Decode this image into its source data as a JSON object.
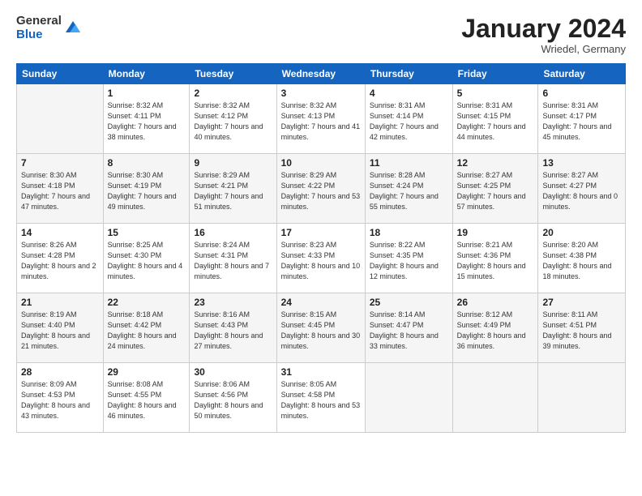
{
  "logo": {
    "general": "General",
    "blue": "Blue"
  },
  "title": "January 2024",
  "location": "Wriedel, Germany",
  "weekdays": [
    "Sunday",
    "Monday",
    "Tuesday",
    "Wednesday",
    "Thursday",
    "Friday",
    "Saturday"
  ],
  "weeks": [
    [
      {
        "num": "",
        "sunrise": "",
        "sunset": "",
        "daylight": ""
      },
      {
        "num": "1",
        "sunrise": "Sunrise: 8:32 AM",
        "sunset": "Sunset: 4:11 PM",
        "daylight": "Daylight: 7 hours and 38 minutes."
      },
      {
        "num": "2",
        "sunrise": "Sunrise: 8:32 AM",
        "sunset": "Sunset: 4:12 PM",
        "daylight": "Daylight: 7 hours and 40 minutes."
      },
      {
        "num": "3",
        "sunrise": "Sunrise: 8:32 AM",
        "sunset": "Sunset: 4:13 PM",
        "daylight": "Daylight: 7 hours and 41 minutes."
      },
      {
        "num": "4",
        "sunrise": "Sunrise: 8:31 AM",
        "sunset": "Sunset: 4:14 PM",
        "daylight": "Daylight: 7 hours and 42 minutes."
      },
      {
        "num": "5",
        "sunrise": "Sunrise: 8:31 AM",
        "sunset": "Sunset: 4:15 PM",
        "daylight": "Daylight: 7 hours and 44 minutes."
      },
      {
        "num": "6",
        "sunrise": "Sunrise: 8:31 AM",
        "sunset": "Sunset: 4:17 PM",
        "daylight": "Daylight: 7 hours and 45 minutes."
      }
    ],
    [
      {
        "num": "7",
        "sunrise": "Sunrise: 8:30 AM",
        "sunset": "Sunset: 4:18 PM",
        "daylight": "Daylight: 7 hours and 47 minutes."
      },
      {
        "num": "8",
        "sunrise": "Sunrise: 8:30 AM",
        "sunset": "Sunset: 4:19 PM",
        "daylight": "Daylight: 7 hours and 49 minutes."
      },
      {
        "num": "9",
        "sunrise": "Sunrise: 8:29 AM",
        "sunset": "Sunset: 4:21 PM",
        "daylight": "Daylight: 7 hours and 51 minutes."
      },
      {
        "num": "10",
        "sunrise": "Sunrise: 8:29 AM",
        "sunset": "Sunset: 4:22 PM",
        "daylight": "Daylight: 7 hours and 53 minutes."
      },
      {
        "num": "11",
        "sunrise": "Sunrise: 8:28 AM",
        "sunset": "Sunset: 4:24 PM",
        "daylight": "Daylight: 7 hours and 55 minutes."
      },
      {
        "num": "12",
        "sunrise": "Sunrise: 8:27 AM",
        "sunset": "Sunset: 4:25 PM",
        "daylight": "Daylight: 7 hours and 57 minutes."
      },
      {
        "num": "13",
        "sunrise": "Sunrise: 8:27 AM",
        "sunset": "Sunset: 4:27 PM",
        "daylight": "Daylight: 8 hours and 0 minutes."
      }
    ],
    [
      {
        "num": "14",
        "sunrise": "Sunrise: 8:26 AM",
        "sunset": "Sunset: 4:28 PM",
        "daylight": "Daylight: 8 hours and 2 minutes."
      },
      {
        "num": "15",
        "sunrise": "Sunrise: 8:25 AM",
        "sunset": "Sunset: 4:30 PM",
        "daylight": "Daylight: 8 hours and 4 minutes."
      },
      {
        "num": "16",
        "sunrise": "Sunrise: 8:24 AM",
        "sunset": "Sunset: 4:31 PM",
        "daylight": "Daylight: 8 hours and 7 minutes."
      },
      {
        "num": "17",
        "sunrise": "Sunrise: 8:23 AM",
        "sunset": "Sunset: 4:33 PM",
        "daylight": "Daylight: 8 hours and 10 minutes."
      },
      {
        "num": "18",
        "sunrise": "Sunrise: 8:22 AM",
        "sunset": "Sunset: 4:35 PM",
        "daylight": "Daylight: 8 hours and 12 minutes."
      },
      {
        "num": "19",
        "sunrise": "Sunrise: 8:21 AM",
        "sunset": "Sunset: 4:36 PM",
        "daylight": "Daylight: 8 hours and 15 minutes."
      },
      {
        "num": "20",
        "sunrise": "Sunrise: 8:20 AM",
        "sunset": "Sunset: 4:38 PM",
        "daylight": "Daylight: 8 hours and 18 minutes."
      }
    ],
    [
      {
        "num": "21",
        "sunrise": "Sunrise: 8:19 AM",
        "sunset": "Sunset: 4:40 PM",
        "daylight": "Daylight: 8 hours and 21 minutes."
      },
      {
        "num": "22",
        "sunrise": "Sunrise: 8:18 AM",
        "sunset": "Sunset: 4:42 PM",
        "daylight": "Daylight: 8 hours and 24 minutes."
      },
      {
        "num": "23",
        "sunrise": "Sunrise: 8:16 AM",
        "sunset": "Sunset: 4:43 PM",
        "daylight": "Daylight: 8 hours and 27 minutes."
      },
      {
        "num": "24",
        "sunrise": "Sunrise: 8:15 AM",
        "sunset": "Sunset: 4:45 PM",
        "daylight": "Daylight: 8 hours and 30 minutes."
      },
      {
        "num": "25",
        "sunrise": "Sunrise: 8:14 AM",
        "sunset": "Sunset: 4:47 PM",
        "daylight": "Daylight: 8 hours and 33 minutes."
      },
      {
        "num": "26",
        "sunrise": "Sunrise: 8:12 AM",
        "sunset": "Sunset: 4:49 PM",
        "daylight": "Daylight: 8 hours and 36 minutes."
      },
      {
        "num": "27",
        "sunrise": "Sunrise: 8:11 AM",
        "sunset": "Sunset: 4:51 PM",
        "daylight": "Daylight: 8 hours and 39 minutes."
      }
    ],
    [
      {
        "num": "28",
        "sunrise": "Sunrise: 8:09 AM",
        "sunset": "Sunset: 4:53 PM",
        "daylight": "Daylight: 8 hours and 43 minutes."
      },
      {
        "num": "29",
        "sunrise": "Sunrise: 8:08 AM",
        "sunset": "Sunset: 4:55 PM",
        "daylight": "Daylight: 8 hours and 46 minutes."
      },
      {
        "num": "30",
        "sunrise": "Sunrise: 8:06 AM",
        "sunset": "Sunset: 4:56 PM",
        "daylight": "Daylight: 8 hours and 50 minutes."
      },
      {
        "num": "31",
        "sunrise": "Sunrise: 8:05 AM",
        "sunset": "Sunset: 4:58 PM",
        "daylight": "Daylight: 8 hours and 53 minutes."
      },
      {
        "num": "",
        "sunrise": "",
        "sunset": "",
        "daylight": ""
      },
      {
        "num": "",
        "sunrise": "",
        "sunset": "",
        "daylight": ""
      },
      {
        "num": "",
        "sunrise": "",
        "sunset": "",
        "daylight": ""
      }
    ]
  ]
}
